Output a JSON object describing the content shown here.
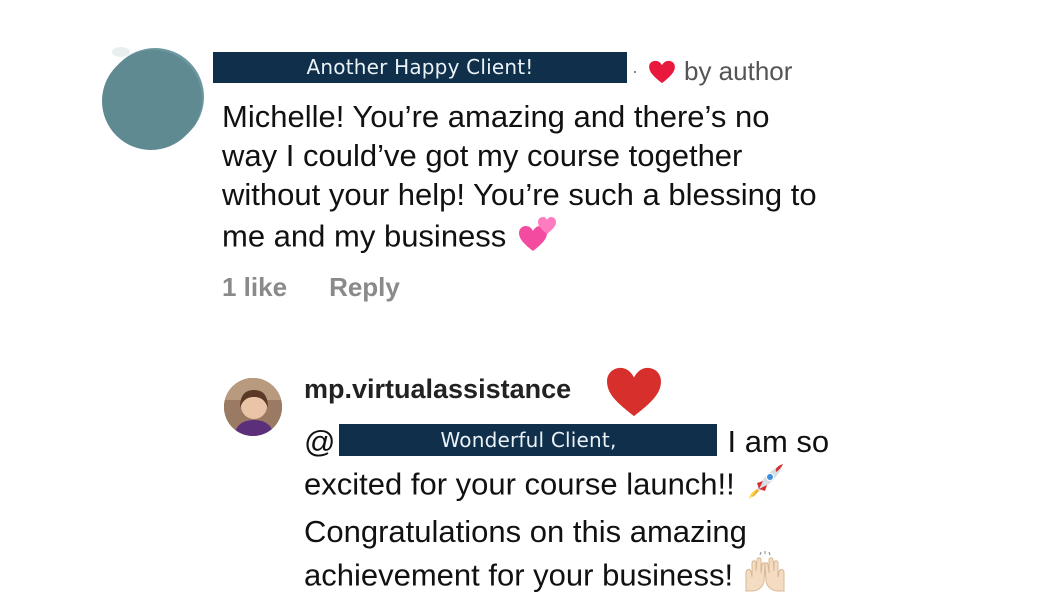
{
  "comment": {
    "author_banner": "Another Happy Client!",
    "separator": "·",
    "by_author": "by author",
    "text": "Michelle! You’re amazing and there’s no\nway I could’ve got my course together\nwithout your help! You’re such a blessing to\nme and my business",
    "likes": "1 like",
    "reply_label": "Reply",
    "avatar_color": "#5f8a91",
    "banner_color": "#0f2f4a",
    "heart_color": "#e8193c"
  },
  "reply": {
    "username": "mp.virtualassistance",
    "mention_symbol": "@",
    "mention_banner": "Wonderful Client,",
    "text_line1": "I am so",
    "text_rest_1": "excited for your course launch!!",
    "text_rest_2": "Congratulations on this amazing",
    "text_rest_3": "achievement for your business!",
    "heart_color": "#d7302c"
  }
}
